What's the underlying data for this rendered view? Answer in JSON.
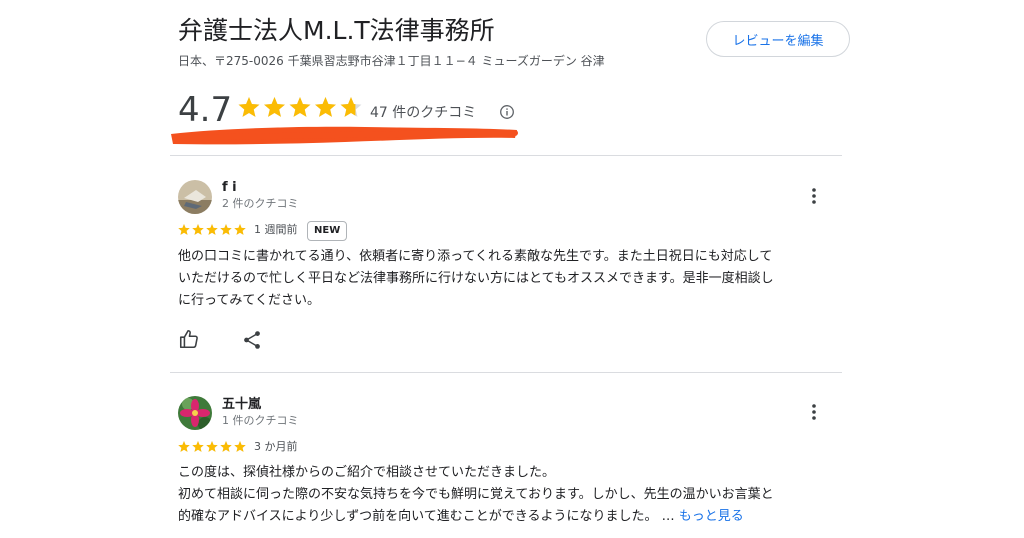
{
  "header": {
    "title": "弁護士法人M.L.T法律事務所",
    "address": "日本、〒275-0026 千葉県習志野市谷津１丁目１１−４ ミューズガーデン 谷津",
    "edit_review_label": "レビューを編集"
  },
  "rating": {
    "value": "4.7",
    "stars": 4.7,
    "count_label": "47 件のクチコミ",
    "star_color": "#fbbc04"
  },
  "reviews": [
    {
      "name": "f i",
      "meta": "2 件のクチコミ",
      "stars": 5,
      "date": "1 週間前",
      "badge": "NEW",
      "text": [
        "他の口コミに書かれてる通り、依頼者に寄り添ってくれる素敵な先生です。また土日祝日にも対応して",
        "いただけるので忙しく平日など法律事務所に行けない方にはとてもオススメできます。是非一度相談し",
        "に行ってみてください。"
      ]
    },
    {
      "name": "五十嵐",
      "meta": "1 件のクチコミ",
      "stars": 5,
      "date": "3 か月前",
      "text": [
        "この度は、探偵社様からのご紹介で相談させていただきました。",
        "初めて相談に伺った際の不安な気持ちを今でも鮮明に覚えております。しかし、先生の温かいお言葉と",
        "的確なアドバイスにより少しずつ前を向いて進むことができるようになりました。 … "
      ],
      "more_label": "もっと見る"
    }
  ],
  "icons": {
    "info": "info-icon",
    "more": "more-vert-icon",
    "like": "thumb-up-icon",
    "share": "share-icon"
  },
  "colors": {
    "accent": "#1a73e8",
    "highlight_stroke": "#f4511e"
  }
}
